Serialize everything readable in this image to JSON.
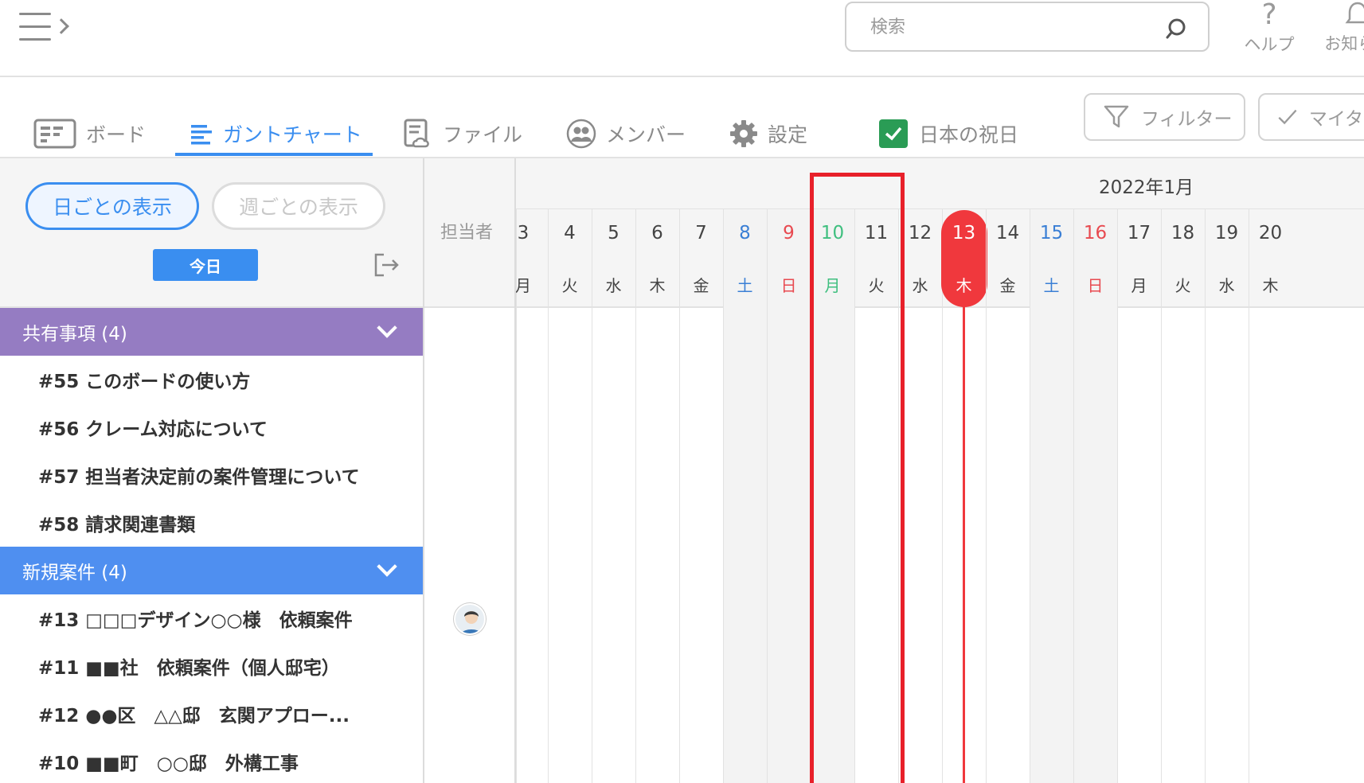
{
  "header": {
    "search_placeholder": "検索",
    "help_label": "ヘルプ",
    "help_glyph": "?",
    "notice_label": "お知らせ"
  },
  "tabs": [
    {
      "label": "ボード"
    },
    {
      "label": "ガントチャート"
    },
    {
      "label": "ファイル"
    },
    {
      "label": "メンバー"
    },
    {
      "label": "設定"
    }
  ],
  "holiday_toggle": {
    "label": "日本の祝日",
    "checked": true
  },
  "filter_label": "フィルター",
  "mytask_label": "マイタスク",
  "view_toggle": {
    "daily": "日ごとの表示",
    "weekly": "週ごとの表示"
  },
  "today_label": "今日",
  "groups": [
    {
      "title": "共有事項 (4)",
      "color": "#957cc2",
      "tasks": [
        "#55 このボードの使い方",
        "#56 クレーム対応について",
        "#57 担当者決定前の案件管理について",
        "#58 請求関連書類"
      ]
    },
    {
      "title": "新規案件 (4)",
      "color": "#4f8ff0",
      "tasks": [
        "#13 □□□デザイン○○様　依頼案件",
        "#11 ■■社　依頼案件（個人邸宅）",
        "#12 ●●区　△△邸　玄関アプロー...",
        "#10 ■■町　○○邸　外構工事"
      ]
    }
  ],
  "gantt": {
    "assignee_label": "担当者",
    "month": "2022年1月",
    "days": [
      {
        "d": "3",
        "w": "月",
        "type": "weekday"
      },
      {
        "d": "4",
        "w": "火",
        "type": "weekday"
      },
      {
        "d": "5",
        "w": "水",
        "type": "weekday"
      },
      {
        "d": "6",
        "w": "木",
        "type": "weekday"
      },
      {
        "d": "7",
        "w": "金",
        "type": "weekday"
      },
      {
        "d": "8",
        "w": "土",
        "type": "saturday"
      },
      {
        "d": "9",
        "w": "日",
        "type": "sunday"
      },
      {
        "d": "10",
        "w": "月",
        "type": "holiday"
      },
      {
        "d": "11",
        "w": "火",
        "type": "weekday"
      },
      {
        "d": "12",
        "w": "水",
        "type": "weekday"
      },
      {
        "d": "13",
        "w": "木",
        "type": "today"
      },
      {
        "d": "14",
        "w": "金",
        "type": "weekday"
      },
      {
        "d": "15",
        "w": "土",
        "type": "saturday"
      },
      {
        "d": "16",
        "w": "日",
        "type": "sunday"
      },
      {
        "d": "17",
        "w": "月",
        "type": "weekday"
      },
      {
        "d": "18",
        "w": "火",
        "type": "weekday"
      },
      {
        "d": "19",
        "w": "水",
        "type": "weekday"
      },
      {
        "d": "20",
        "w": "木",
        "type": "weekday"
      }
    ],
    "colors": {
      "weekday": "#444444",
      "saturday": "#3a7fd5",
      "sunday": "#e84a50",
      "holiday": "#3fbf7f",
      "today": "#ffffff",
      "accent": "#3a8ef0",
      "today_marker": "#f0383d",
      "highlight": "#e8202a"
    }
  }
}
